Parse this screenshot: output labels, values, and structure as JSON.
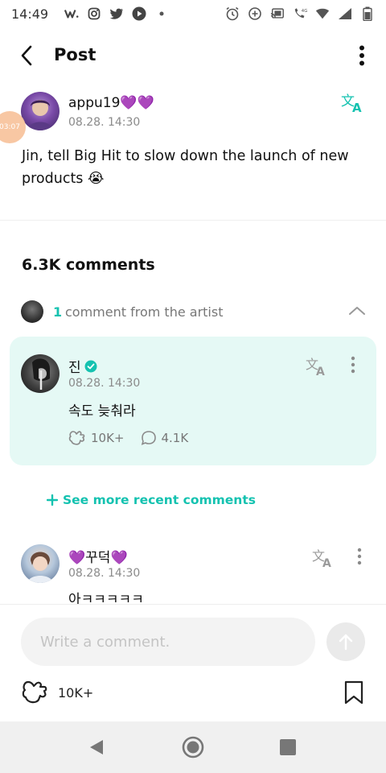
{
  "status_bar": {
    "time": "14:49",
    "network": "4G"
  },
  "header": {
    "title": "Post"
  },
  "post": {
    "author": "appu19💜💜",
    "timestamp": "08.28. 14:30",
    "text": "Jin, tell Big Hit to slow down the launch of new products 😭",
    "floating_badge": "03:07"
  },
  "comments_section": {
    "count_label": "6.3K comments",
    "artist_count": "1",
    "artist_label": "comment from the artist"
  },
  "artist_comment": {
    "name": "진",
    "timestamp": "08.28. 14:30",
    "text": "속도 늦춰라",
    "likes": "10K+",
    "replies": "4.1K"
  },
  "see_more": {
    "label": "See more recent comments"
  },
  "comment2": {
    "name": "💜꾸덕💜",
    "timestamp": "08.28. 14:30",
    "text": "아ㅋㅋㅋㅋㅋ"
  },
  "bottom_bar": {
    "input_placeholder": "Write a comment.",
    "likes": "10K+"
  },
  "colors": {
    "accent": "#14c2b0",
    "artist_card_bg": "#e5f9f5",
    "heart": "#7c2bd0"
  }
}
